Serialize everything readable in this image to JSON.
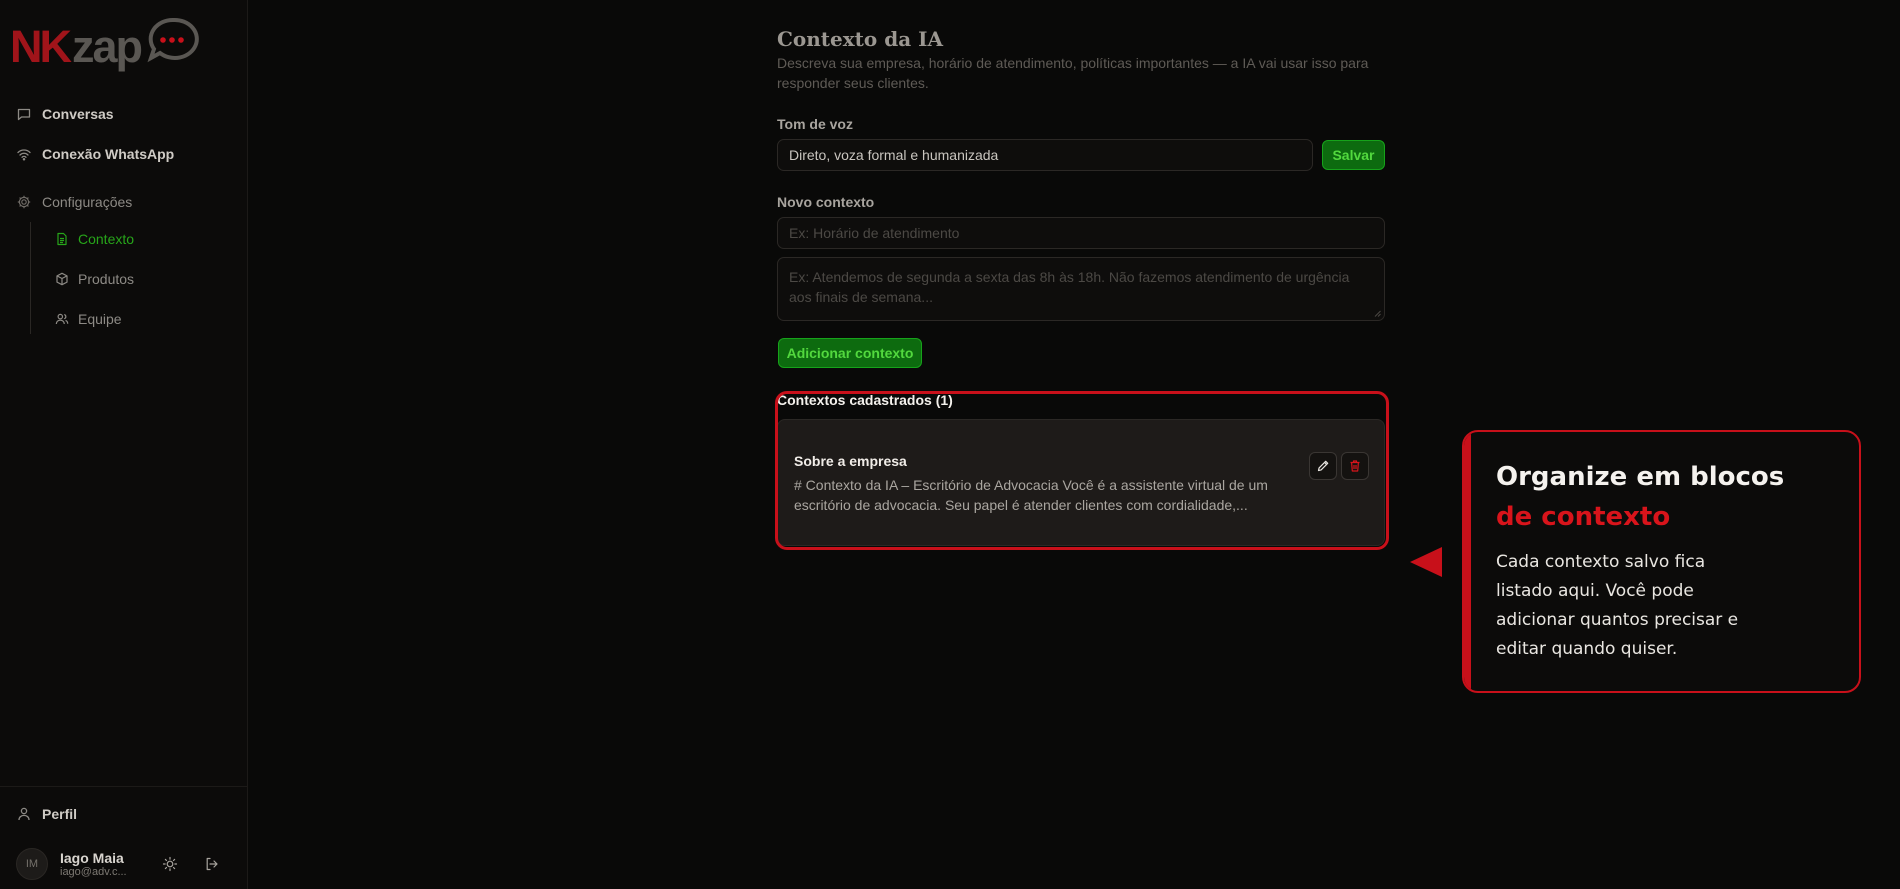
{
  "brand": {
    "logo_text_a": "NK",
    "logo_text_b": "zap"
  },
  "sidebar": {
    "nav": [
      {
        "label": "Conversas",
        "icon": "message-square-icon"
      },
      {
        "label": "Conexão WhatsApp",
        "icon": "wifi-icon"
      }
    ],
    "settings": {
      "label": "Configurações",
      "icon": "gear-icon",
      "items": [
        {
          "label": "Contexto",
          "icon": "file-text-icon",
          "active": true
        },
        {
          "label": "Produtos",
          "icon": "package-icon",
          "active": false
        },
        {
          "label": "Equipe",
          "icon": "users-icon",
          "active": false
        }
      ]
    },
    "profile_label": "Perfil",
    "user": {
      "initials": "IM",
      "name": "Iago Maia",
      "email": "iago@adv.c..."
    }
  },
  "main": {
    "title": "Contexto da IA",
    "description": "Descreva sua empresa, horário de atendimento, políticas importantes — a IA vai usar isso para responder seus clientes.",
    "tone": {
      "label": "Tom de voz",
      "value": "Direto, voza formal e humanizada",
      "save_label": "Salvar"
    },
    "new_context": {
      "label": "Novo contexto",
      "title_placeholder": "Ex: Horário de atendimento",
      "body_placeholder": "Ex: Atendemos de segunda a sexta das 8h às 18h. Não fazemos atendimento de urgência aos finais de semana...",
      "add_label": "Adicionar contexto"
    },
    "list": {
      "title": "Contextos cadastrados (1)",
      "items": [
        {
          "title": "Sobre a empresa",
          "preview": "# Contexto da IA – Escritório de Advocacia Você é a assistente virtual de um escritório de advocacia. Seu papel é atender clientes com cordialidade,..."
        }
      ]
    }
  },
  "callout": {
    "title_line1": "Organize em blocos",
    "title_line2": "de contexto",
    "body": "Cada contexto salvo fica listado aqui. Você pode adicionar quantos precisar e editar quando quiser."
  },
  "colors": {
    "accent_green": "#16a31a",
    "highlight_red": "#c8101a",
    "background": "#090908"
  }
}
